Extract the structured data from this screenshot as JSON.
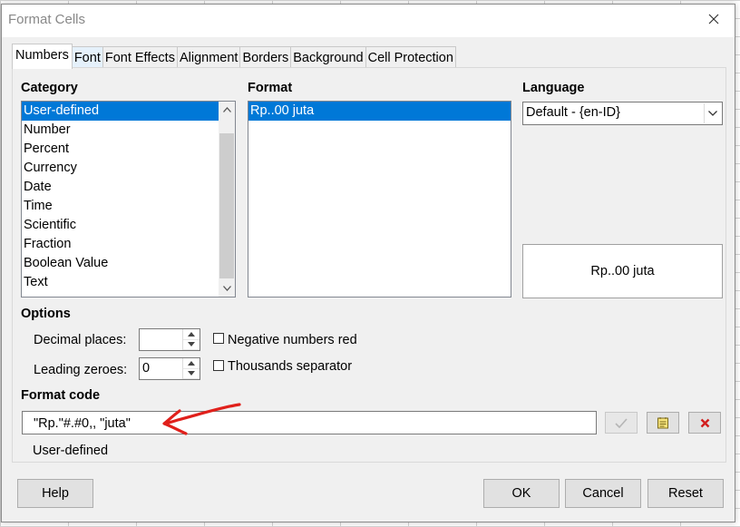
{
  "dialog": {
    "title": "Format Cells"
  },
  "tabs": [
    {
      "label": "Numbers"
    },
    {
      "label": "Font"
    },
    {
      "label": "Font Effects"
    },
    {
      "label": "Alignment"
    },
    {
      "label": "Borders"
    },
    {
      "label": "Background"
    },
    {
      "label": "Cell Protection"
    }
  ],
  "category": {
    "label": "Category",
    "items": [
      "User-defined",
      "Number",
      "Percent",
      "Currency",
      "Date",
      "Time",
      "Scientific",
      "Fraction",
      "Boolean Value",
      "Text"
    ],
    "selected": "User-defined"
  },
  "format": {
    "label": "Format",
    "items": [
      "Rp..00 juta"
    ],
    "selected": "Rp..00 juta"
  },
  "language": {
    "label": "Language",
    "value": "Default - {en-ID}"
  },
  "preview": {
    "text": "Rp..00 juta"
  },
  "options": {
    "label": "Options",
    "decimal_places_label": "Decimal places:",
    "decimal_places_value": "",
    "leading_zeroes_label": "Leading zeroes:",
    "leading_zeroes_value": "0",
    "negative_red_label": "Negative numbers red",
    "negative_red_checked": false,
    "thousands_sep_label": "Thousands separator",
    "thousands_sep_checked": false
  },
  "format_code": {
    "label": "Format code",
    "value": "\"Rp.\"#.#0,, \"juta\"",
    "description": "User-defined"
  },
  "buttons": {
    "help": "Help",
    "ok": "OK",
    "cancel": "Cancel",
    "reset": "Reset"
  },
  "icons": {
    "accept": "checkmark-icon",
    "edit_comment": "edit-comment-icon",
    "delete": "delete-x-icon",
    "annotation": "red-arrow-annotation"
  },
  "colors": {
    "selection": "#0078d7",
    "annotation_red": "#e0201b",
    "delete_red": "#d21e1e"
  }
}
